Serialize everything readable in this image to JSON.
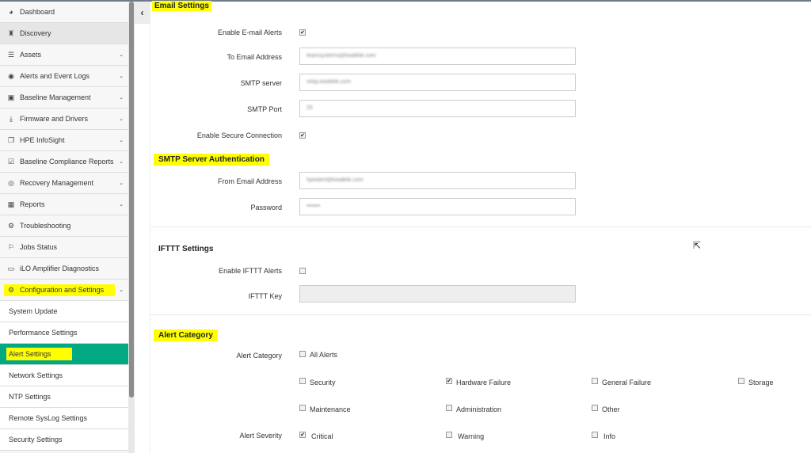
{
  "sidebar": {
    "items": [
      {
        "label": "Dashboard",
        "icon": "dashboard-icon",
        "glyph": "◕"
      },
      {
        "label": "Discovery",
        "icon": "binoculars-icon",
        "glyph": "♜"
      },
      {
        "label": "Assets",
        "icon": "server-icon",
        "glyph": "☰"
      },
      {
        "label": "Alerts and Event Logs",
        "icon": "eye-icon",
        "glyph": "◉"
      },
      {
        "label": "Baseline Management",
        "icon": "baseline-icon",
        "glyph": "▣"
      },
      {
        "label": "Firmware and Drivers",
        "icon": "download-icon",
        "glyph": "⤓"
      },
      {
        "label": "HPE InfoSight",
        "icon": "copy-icon",
        "glyph": "❐"
      },
      {
        "label": "Baseline Compliance Reports",
        "icon": "check-square-icon",
        "glyph": "☑"
      },
      {
        "label": "Recovery Management",
        "icon": "lifebuoy-icon",
        "glyph": "◎"
      },
      {
        "label": "Reports",
        "icon": "table-icon",
        "glyph": "▦"
      },
      {
        "label": "Troubleshooting",
        "icon": "cogs-icon",
        "glyph": "⚙"
      },
      {
        "label": "Jobs Status",
        "icon": "flag-icon",
        "glyph": "⚐"
      },
      {
        "label": "iLO Amplifier Diagnostics",
        "icon": "monitor-icon",
        "glyph": "▭"
      },
      {
        "label": "Configuration and Settings",
        "icon": "gear-icon",
        "glyph": "⚙"
      }
    ],
    "subitems": [
      "System Update",
      "Performance Settings",
      "Alert Settings",
      "Network Settings",
      "NTP Settings",
      "Remote SysLog Settings",
      "Security Settings"
    ]
  },
  "email": {
    "title": "Email Settings",
    "enable_label": "Enable E-mail Alerts",
    "enable_checked": true,
    "to_label": "To Email Address",
    "to_value": "teamsystems@kwalklik.com",
    "smtp_label": "SMTP server",
    "smtp_value": "relay.kwalklik.com",
    "port_label": "SMTP Port",
    "port_value": "25",
    "secure_label": "Enable Secure Connection",
    "secure_checked": true
  },
  "auth": {
    "title": "SMTP Server Authentication",
    "from_label": "From Email Address",
    "from_value": "hpealert@kwalklik.com",
    "password_label": "Password",
    "password_value": "•••••••"
  },
  "ifttt": {
    "title": "IFTTT Settings",
    "enable_label": "Enable IFTTT Alerts",
    "enable_checked": false,
    "key_label": "IFTTT Key",
    "key_value": ""
  },
  "category": {
    "title": "Alert Category",
    "label": "Alert Category",
    "all": "All Alerts",
    "options": [
      "Security",
      "Hardware Failure",
      "General Failure",
      "Storage",
      "Maintenance",
      "Administration",
      "Other"
    ],
    "checked": [
      false,
      true,
      false,
      false,
      false,
      false,
      false
    ],
    "severity_label": "Alert Severity",
    "severities": [
      "Critical",
      "Warning",
      "Info"
    ],
    "severity_checked": [
      true,
      false,
      false
    ]
  },
  "colors": {
    "accent": "#01a982",
    "highlight": "#ffff00"
  }
}
